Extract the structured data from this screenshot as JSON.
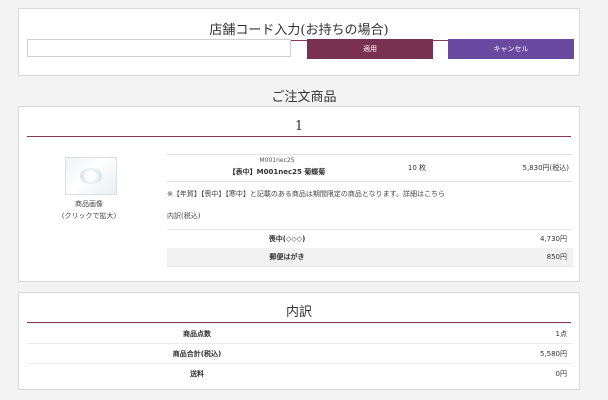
{
  "store_code": {
    "title": "店舗コード入力(お持ちの場合)",
    "input_value": "",
    "apply_label": "適用",
    "cancel_label": "キャンセル"
  },
  "order_heading": "ご注文商品",
  "order_item": {
    "index": "1",
    "image_caption_line1": "商品画像",
    "image_caption_line2": "(クリックで拡大)",
    "code": "M001nec25",
    "name": "【表中】M001nec25 菊蝶菊",
    "quantity": "10 枚",
    "price": "5,830円(税込)",
    "notice": "※【年賀】【喪中】【寒中】と記載のある商品は期間限定の商品となります。詳細はこちら",
    "breakdown_note": "内訳(税込)",
    "lines": [
      {
        "label": "喪中(◇◇◇)",
        "value": "4,730円"
      },
      {
        "label": "郵便はがき",
        "value": "850円"
      }
    ]
  },
  "breakdown": {
    "title": "内訳",
    "rows": [
      {
        "label": "商品点数",
        "value": "1点"
      },
      {
        "label": "商品合計(税込)",
        "value": "5,580円"
      },
      {
        "label": "送料",
        "value": "0円"
      }
    ]
  },
  "colors": {
    "accent_rule": "#8a3a55",
    "apply_button": "#7a3050",
    "cancel_button": "#6a4aa0"
  }
}
